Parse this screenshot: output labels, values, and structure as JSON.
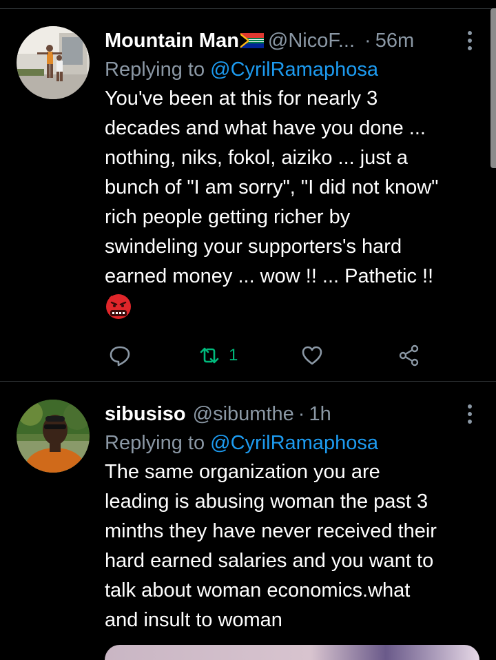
{
  "tweets": [
    {
      "display_name": "Mountain Man",
      "handle": "@NicoF...",
      "separator": "·",
      "time": "56m",
      "reply_prefix": "Replying to ",
      "reply_to": "@CyrilRamaphosa",
      "lines": [
        "You've been at this for nearly 3",
        "decades and what have you done ...",
        "nothing, niks, fokol, aiziko ... just a",
        "bunch of \"I am sorry\", \"I did not know\"",
        "rich people getting richer by",
        "swindeling your supporters's hard",
        "earned money ... wow !! ... Pathetic !!"
      ],
      "emoji": "face-with-symbols-on-mouth",
      "retweet_count": "1"
    },
    {
      "display_name": "sibusiso",
      "handle": "@sibumthe",
      "separator": "·",
      "time": "1h",
      "reply_prefix": "Replying to ",
      "reply_to": "@CyrilRamaphosa",
      "lines": [
        "The same organization you are",
        "leading is abusing woman the past 3",
        "minths they have never received their",
        "hard earned salaries and you want to",
        "talk about woman economics.what",
        "and insult to woman"
      ]
    }
  ],
  "colors": {
    "background": "#000000",
    "secondary_text": "#8b98a5",
    "link": "#1d9bf0",
    "retweet_active": "#00ba7c",
    "divider": "#2f3336"
  },
  "icons": {
    "reply": "speech-bubble-icon",
    "retweet": "retweet-icon",
    "like": "heart-icon",
    "share": "share-nodes-icon",
    "more": "vertical-ellipsis-icon"
  }
}
